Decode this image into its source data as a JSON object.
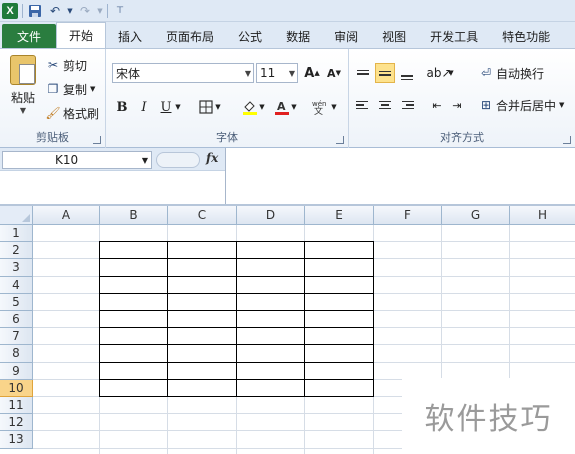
{
  "qat": {
    "logo": "X",
    "items": [
      "save-icon",
      "undo-icon",
      "redo-icon",
      "customize-icon"
    ]
  },
  "tabs": {
    "file": "文件",
    "items": [
      "开始",
      "插入",
      "页面布局",
      "公式",
      "数据",
      "审阅",
      "视图",
      "开发工具",
      "特色功能"
    ],
    "active": "开始"
  },
  "ribbon": {
    "clipboard": {
      "label": "剪贴板",
      "paste": "粘贴",
      "cut": "剪切",
      "copy": "复制",
      "format_painter": "格式刷"
    },
    "font": {
      "label": "字体",
      "font_name": "宋体",
      "font_size": "11",
      "bold": "B",
      "italic": "I",
      "underline": "U",
      "grow": "A",
      "shrink": "A"
    },
    "alignment": {
      "label": "对齐方式",
      "wrap_text": "自动换行",
      "merge_center": "合并后居中"
    }
  },
  "formula_bar": {
    "name_box": "K10",
    "fx": "fx",
    "value": ""
  },
  "sheet": {
    "columns": [
      "A",
      "B",
      "C",
      "D",
      "E",
      "F",
      "G",
      "H"
    ],
    "rows": [
      "1",
      "2",
      "3",
      "4",
      "5",
      "6",
      "7",
      "8",
      "9",
      "10",
      "11",
      "12",
      "13"
    ],
    "selected_row": "10",
    "bordered_range": "B2:E10"
  },
  "watermark": "软件技巧",
  "colors": {
    "file_tab": "#2a7d3f",
    "ribbon_bg": "#dfe9f5",
    "selected_header": "#f9d48a"
  }
}
